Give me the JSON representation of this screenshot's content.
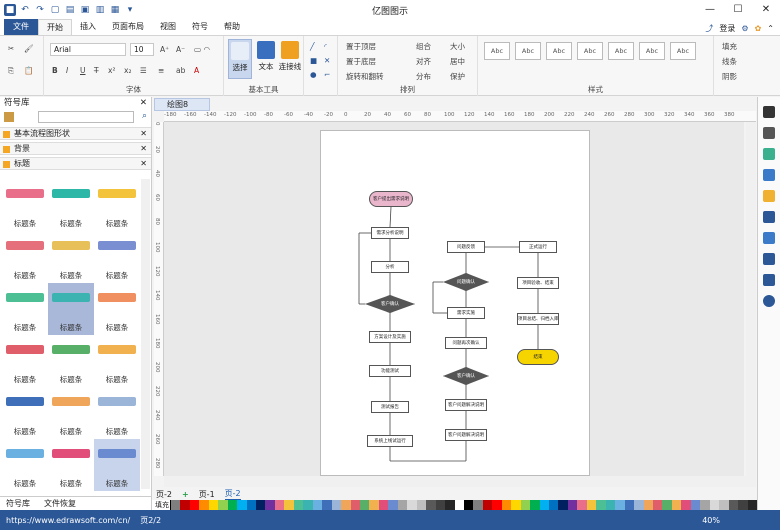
{
  "app": {
    "title": "亿图图示"
  },
  "menu": {
    "file": "文件",
    "tabs": [
      "开始",
      "插入",
      "页面布局",
      "视图",
      "符号",
      "帮助"
    ],
    "login": "登录"
  },
  "ribbon": {
    "font_name": "Arial",
    "font_size": "10",
    "groups": {
      "font": "字体",
      "basic_tools": "基本工具",
      "arrange": "排列",
      "style": "样式"
    },
    "tools": {
      "select": "选择",
      "text": "文本",
      "connector": "连接线"
    },
    "arrange_items": [
      "置于顶层",
      "置于底层",
      "旋转和翻转",
      "组合",
      "对齐",
      "分布",
      "大小",
      "居中",
      "保护"
    ],
    "style_label": "Abc",
    "right_items": [
      "填充",
      "线条",
      "阴影"
    ]
  },
  "library": {
    "title": "符号库",
    "sections": [
      "基本流程图形状",
      "背景",
      "标题"
    ],
    "item_label": "标题条",
    "ribbon_colors": [
      "#e86e8a",
      "#2cb7a6",
      "#f3c33c",
      "#e56f7b",
      "#e8c05a",
      "#7a8fd1",
      "#4cbf95",
      "#3bb3b0",
      "#f08f5f",
      "#e05e6a",
      "#58b068",
      "#f0b14e",
      "#3f6fb8",
      "#f0a65a",
      "#9bb5d8",
      "#6ab0e0",
      "#e24e7a",
      "#6a8bd0"
    ],
    "tabs": [
      "符号库",
      "文件恢复"
    ]
  },
  "document": {
    "tab": "绘图8"
  },
  "ruler": {
    "h": [
      "-180",
      "-160",
      "-140",
      "-120",
      "-100",
      "-80",
      "-60",
      "-40",
      "-20",
      "0",
      "20",
      "40",
      "60",
      "80",
      "100",
      "120",
      "140",
      "160",
      "180",
      "200",
      "220",
      "240",
      "260",
      "280",
      "300",
      "320",
      "340",
      "360",
      "380"
    ],
    "v": [
      "0",
      "20",
      "40",
      "60",
      "80",
      "100",
      "120",
      "140",
      "160",
      "180",
      "200",
      "220",
      "240",
      "260",
      "280"
    ]
  },
  "diagram": {
    "nodes": [
      {
        "text": "客户提出需求说明",
        "shape": "terminator",
        "color": "#e9b6cc"
      },
      {
        "text": "需求分析说明",
        "shape": "process"
      },
      {
        "text": "分析",
        "shape": "process"
      },
      {
        "text": "客户确认",
        "shape": "decision"
      },
      {
        "text": "方案设计及实施",
        "shape": "process"
      },
      {
        "text": "功能测试",
        "shape": "process"
      },
      {
        "text": "测试报告",
        "shape": "process"
      },
      {
        "text": "系统上线试运行",
        "shape": "process"
      },
      {
        "text": "问题反馈",
        "shape": "process"
      },
      {
        "text": "问题确认",
        "shape": "decision"
      },
      {
        "text": "需求实施",
        "shape": "process"
      },
      {
        "text": "问题再次确认",
        "shape": "process"
      },
      {
        "text": "客户确认",
        "shape": "decision"
      },
      {
        "text": "客户问题解决说明",
        "shape": "process"
      },
      {
        "text": "客户问题解决说明",
        "shape": "process"
      },
      {
        "text": "正式运行",
        "shape": "process"
      },
      {
        "text": "项目验收、结束",
        "shape": "process"
      },
      {
        "text": "项目总结、归档入库",
        "shape": "process"
      },
      {
        "text": "结束",
        "shape": "terminator",
        "color": "#f6d400"
      }
    ]
  },
  "pages": {
    "current": "页-2",
    "tabs": [
      "页-1",
      "页-2"
    ],
    "add": "+"
  },
  "palette_label": "填充",
  "status": {
    "url": "https://www.edrawsoft.com/cn/",
    "page": "页2/2",
    "zoom": "40%"
  }
}
